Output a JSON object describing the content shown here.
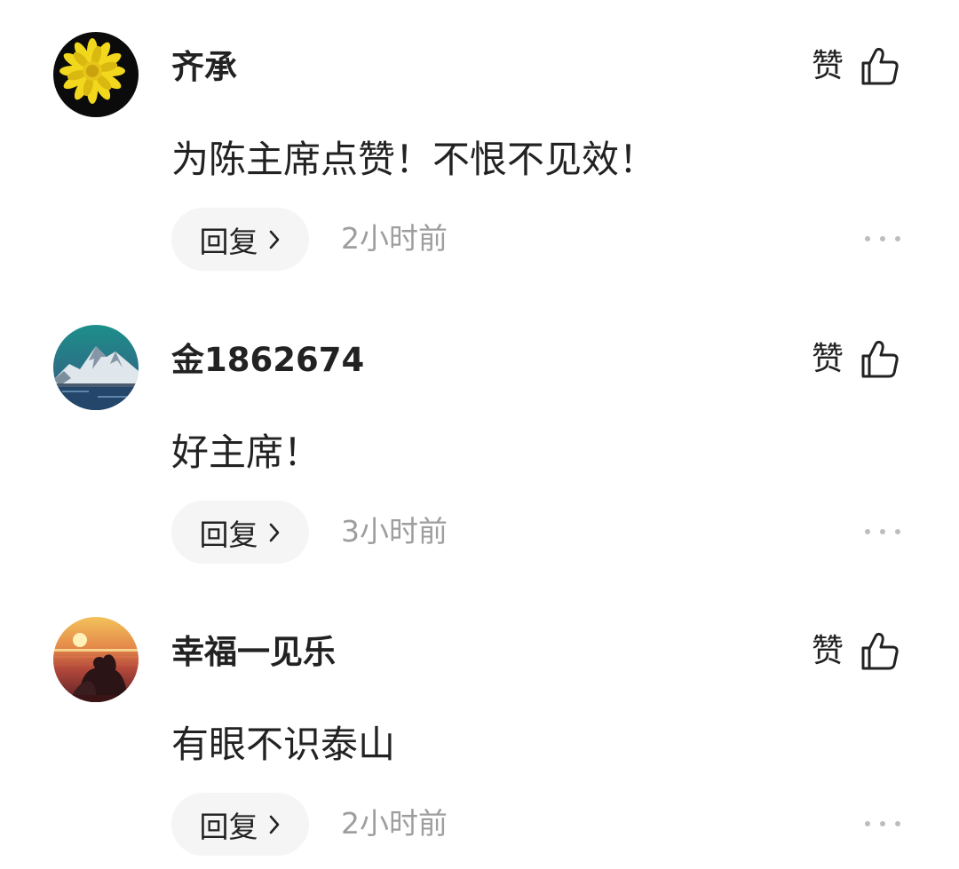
{
  "comments": [
    {
      "avatar": "sunflower-avatar",
      "username": "齐承",
      "like_label": "赞",
      "content": "为陈主席点赞！不恨不见效！",
      "reply_label": "回复",
      "time": "2小时前"
    },
    {
      "avatar": "mountain-avatar",
      "username": "金1862674",
      "like_label": "赞",
      "content": "好主席！",
      "reply_label": "回复",
      "time": "3小时前"
    },
    {
      "avatar": "sunset-couple-avatar",
      "username": "幸福一见乐",
      "like_label": "赞",
      "content": "有眼不识泰山",
      "reply_label": "回复",
      "time": "2小时前"
    }
  ],
  "icons": {
    "like": "thumbs-up-icon",
    "reply": "chevron-right-icon",
    "more": "more-dots-icon"
  },
  "colors": {
    "text_primary": "#222222",
    "text_secondary": "#9e9e9e",
    "pill_background": "#f5f5f5",
    "dots": "#bdbdbd"
  }
}
